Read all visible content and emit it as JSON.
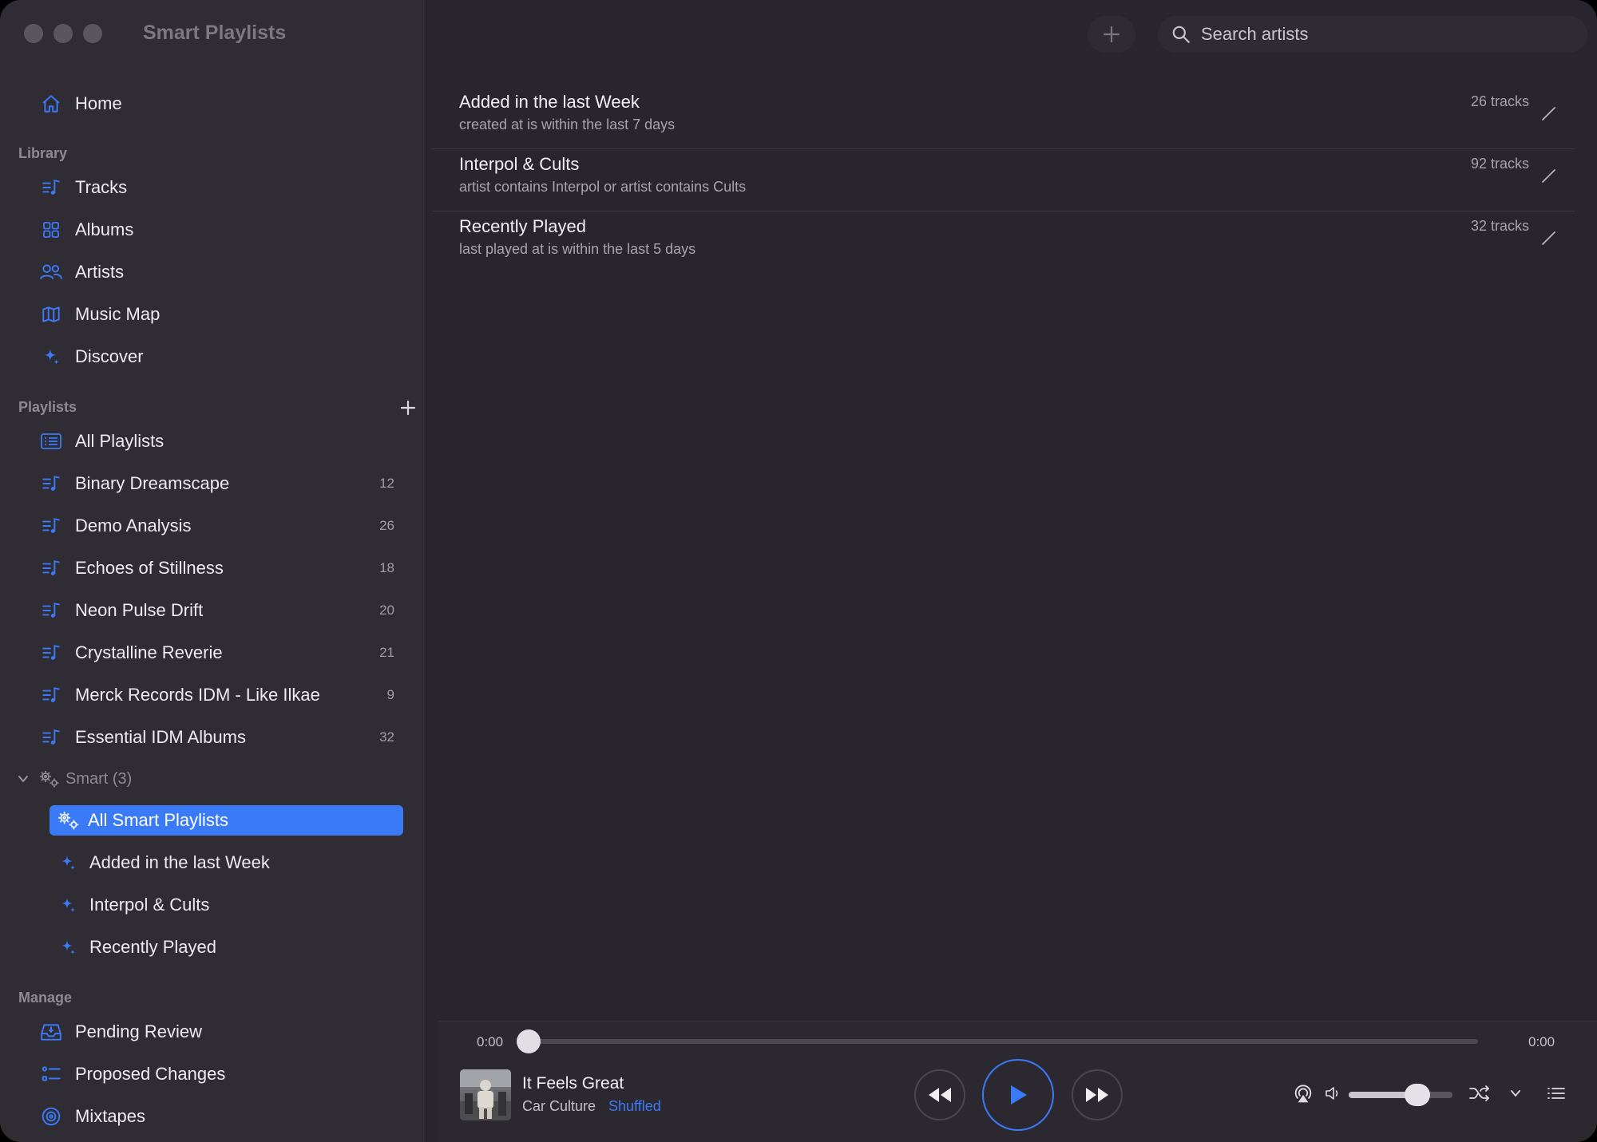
{
  "window": {
    "title": "Smart Playlists"
  },
  "toolbar": {
    "search_placeholder": "Search artists"
  },
  "sidebar": {
    "home_label": "Home",
    "library_heading": "Library",
    "library_items": [
      {
        "label": "Tracks",
        "icon": "tracks-icon"
      },
      {
        "label": "Albums",
        "icon": "albums-icon"
      },
      {
        "label": "Artists",
        "icon": "artists-icon"
      },
      {
        "label": "Music Map",
        "icon": "map-icon"
      },
      {
        "label": "Discover",
        "icon": "sparkle-icon"
      }
    ],
    "playlists_heading": "Playlists",
    "all_playlists_label": "All Playlists",
    "playlists": [
      {
        "label": "Binary Dreamscape",
        "count": "12"
      },
      {
        "label": "Demo Analysis",
        "count": "26"
      },
      {
        "label": "Echoes of Stillness",
        "count": "18"
      },
      {
        "label": "Neon Pulse Drift",
        "count": "20"
      },
      {
        "label": "Crystalline Reverie",
        "count": "21"
      },
      {
        "label": "Merck Records IDM - Like Ilkae",
        "count": "9"
      },
      {
        "label": "Essential IDM Albums",
        "count": "32"
      }
    ],
    "smart_group_label": "Smart (3)",
    "all_smart_label": "All Smart Playlists",
    "smart_items": [
      {
        "label": "Added in the last Week"
      },
      {
        "label": "Interpol & Cults"
      },
      {
        "label": "Recently Played"
      }
    ],
    "manage_heading": "Manage",
    "manage_items": [
      {
        "label": "Pending Review",
        "icon": "inbox-icon"
      },
      {
        "label": "Proposed Changes",
        "icon": "checklist-icon"
      },
      {
        "label": "Mixtapes",
        "icon": "disc-icon"
      }
    ]
  },
  "smart_playlists": [
    {
      "name": "Added in the last Week",
      "rule": "created at is within the last 7 days",
      "tracks": "26 tracks"
    },
    {
      "name": "Interpol & Cults",
      "rule": "artist contains Interpol or artist contains Cults",
      "tracks": "92 tracks"
    },
    {
      "name": "Recently Played",
      "rule": "last played at is within the last 5 days",
      "tracks": "32 tracks"
    }
  ],
  "player": {
    "elapsed": "0:00",
    "duration": "0:00",
    "progress": 0,
    "track_title": "It Feels Great",
    "track_artist": "Car Culture",
    "shuffle_state": "Shuffled",
    "volume": 0.66
  },
  "colors": {
    "accent": "#3a7af6",
    "sidebar_bg": "#302c34",
    "main_bg": "#29252d"
  }
}
